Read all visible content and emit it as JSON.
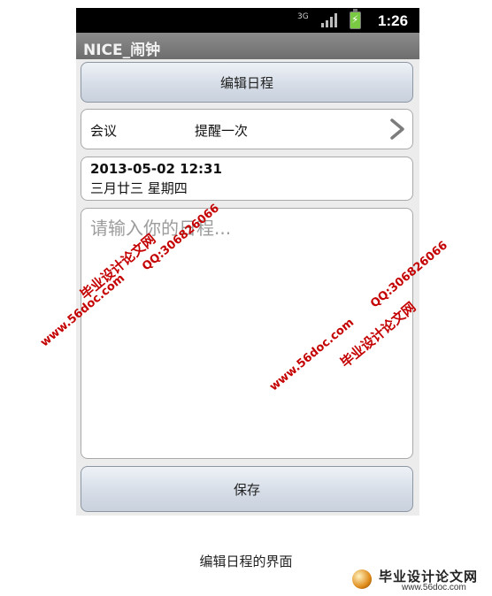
{
  "status_bar": {
    "network": "3G",
    "time": "1:26"
  },
  "app": {
    "title": "NICE_闹钟"
  },
  "header_button": {
    "label": "编辑日程"
  },
  "type_row": {
    "label": "会议",
    "reminder": "提醒一次"
  },
  "datetime": {
    "date": "2013-05-02 12:31",
    "lunar": "三月廿三 星期四"
  },
  "schedule_input": {
    "placeholder": "请输入你的日程..."
  },
  "save_button": {
    "label": "保存"
  },
  "caption": "编辑日程的界面",
  "watermarks": {
    "site_name": "毕业设计论文网",
    "url": "www.56doc.com",
    "qq": "QQ:306826066"
  },
  "logo": {
    "title": "毕业设计论文网",
    "url": "www.56doc.com"
  },
  "colors": {
    "status_bar_bg": "#000000",
    "title_bar_bg": "#7d7d7d",
    "watermark_red": "#c40000",
    "battery_green": "#7ac943"
  }
}
